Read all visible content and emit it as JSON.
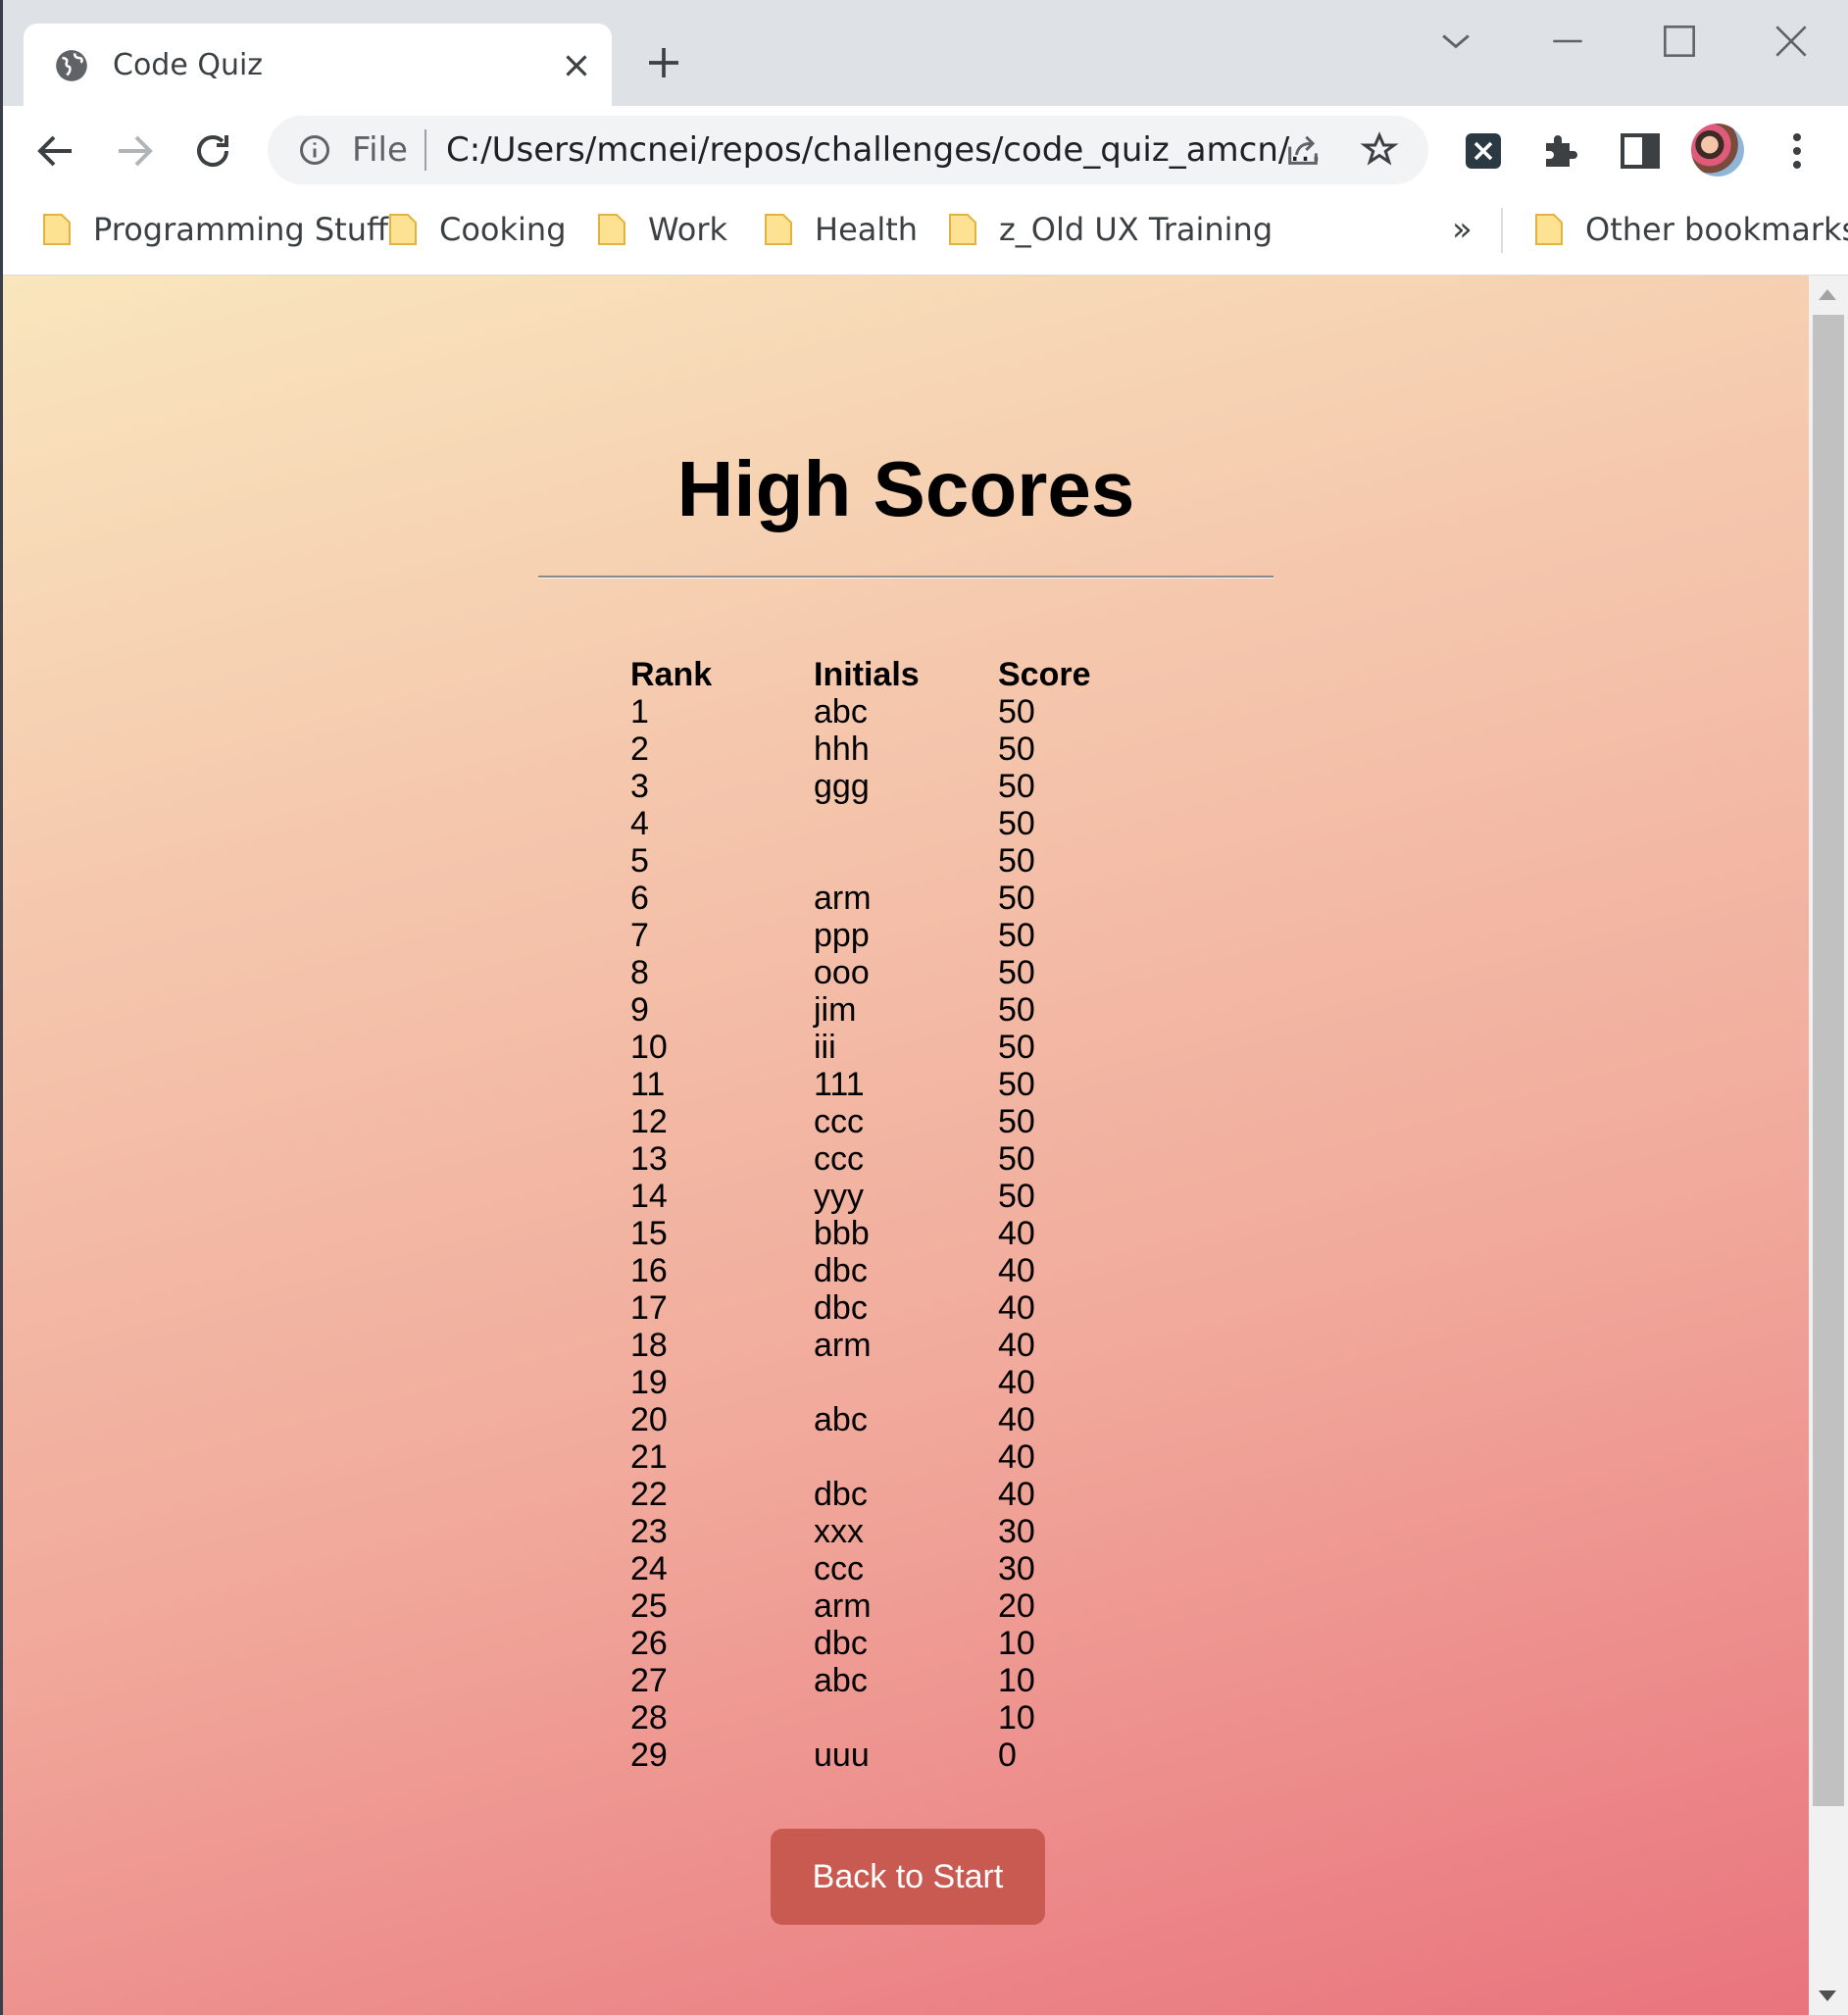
{
  "browser": {
    "tab_title": "Code Quiz",
    "new_tab_glyph": "+",
    "omnibox": {
      "scheme_label": "File",
      "url": "C:/Users/mcnei/repos/challenges/code_quiz_amcn/..."
    },
    "bookmarks": [
      {
        "label": "Programming Stuff"
      },
      {
        "label": "Cooking"
      },
      {
        "label": "Work"
      },
      {
        "label": "Health"
      },
      {
        "label": "z_Old UX Training"
      }
    ],
    "bookmarks_overflow": "»",
    "other_bookmarks": "Other bookmarks"
  },
  "page": {
    "title": "High Scores",
    "columns": [
      "Rank",
      "Initials",
      "Score"
    ],
    "rows": [
      [
        "1",
        "abc",
        "50"
      ],
      [
        "2",
        "hhh",
        "50"
      ],
      [
        "3",
        "ggg",
        "50"
      ],
      [
        "4",
        "",
        "50"
      ],
      [
        "5",
        "",
        "50"
      ],
      [
        "6",
        "arm",
        "50"
      ],
      [
        "7",
        "ppp",
        "50"
      ],
      [
        "8",
        "ooo",
        "50"
      ],
      [
        "9",
        "jim",
        "50"
      ],
      [
        "10",
        "iii",
        "50"
      ],
      [
        "11",
        "111",
        "50"
      ],
      [
        "12",
        "ccc",
        "50"
      ],
      [
        "13",
        "ccc",
        "50"
      ],
      [
        "14",
        "yyy",
        "50"
      ],
      [
        "15",
        "bbb",
        "40"
      ],
      [
        "16",
        "dbc",
        "40"
      ],
      [
        "17",
        "dbc",
        "40"
      ],
      [
        "18",
        "arm",
        "40"
      ],
      [
        "19",
        "",
        "40"
      ],
      [
        "20",
        "abc",
        "40"
      ],
      [
        "21",
        "",
        "40"
      ],
      [
        "22",
        "dbc",
        "40"
      ],
      [
        "23",
        "xxx",
        "30"
      ],
      [
        "24",
        "ccc",
        "30"
      ],
      [
        "25",
        "arm",
        "20"
      ],
      [
        "26",
        "dbc",
        "10"
      ],
      [
        "27",
        "abc",
        "10"
      ],
      [
        "28",
        "",
        "10"
      ],
      [
        "29",
        "uuu",
        "0"
      ]
    ],
    "back_button_label": "Back to Start"
  },
  "colors": {
    "button_bg": "#c95a52",
    "gradient_top": "#f9e6bd",
    "gradient_bottom": "#e9747e"
  }
}
